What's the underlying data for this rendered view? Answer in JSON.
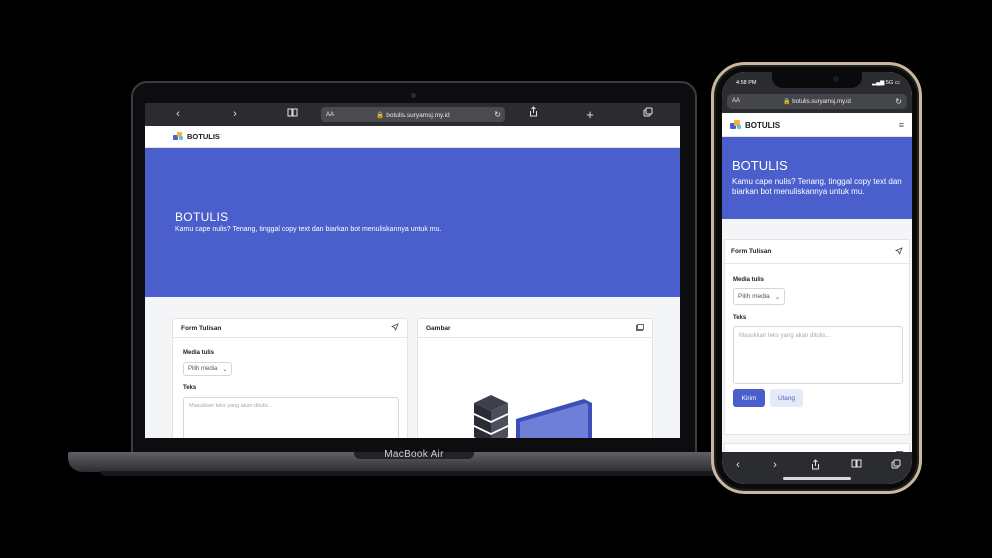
{
  "browser": {
    "host": "botulis.suryamsj.my.id",
    "aa_label": "AA",
    "back_icon": "chevron-left-icon",
    "forward_icon": "chevron-right-icon",
    "reload_icon": "reload-icon"
  },
  "site": {
    "brand": "BOTULIS",
    "hero_title": "BOTULIS",
    "hero_subtitle": "Kamu cape nulis? Tenang, tinggal copy text dan biarkan bot menuliskannya untuk mu.",
    "form_card_title": "Form Tulisan",
    "image_card_title": "Gambar",
    "media_label": "Media tulis",
    "media_selected": "Pilih media",
    "text_label": "Teks",
    "text_placeholder": "Masukkan teks yang akan ditulis...",
    "submit_label": "Kirim",
    "reset_label": "Ulang"
  },
  "phone": {
    "time": "4:58 PM",
    "network": "5G"
  },
  "laptop": {
    "model_label": "MacBook Air"
  },
  "colors": {
    "brand_blue": "#4a5fcc",
    "toolbar_dark": "#2b2c30",
    "page_bg": "#f4f5f7"
  }
}
